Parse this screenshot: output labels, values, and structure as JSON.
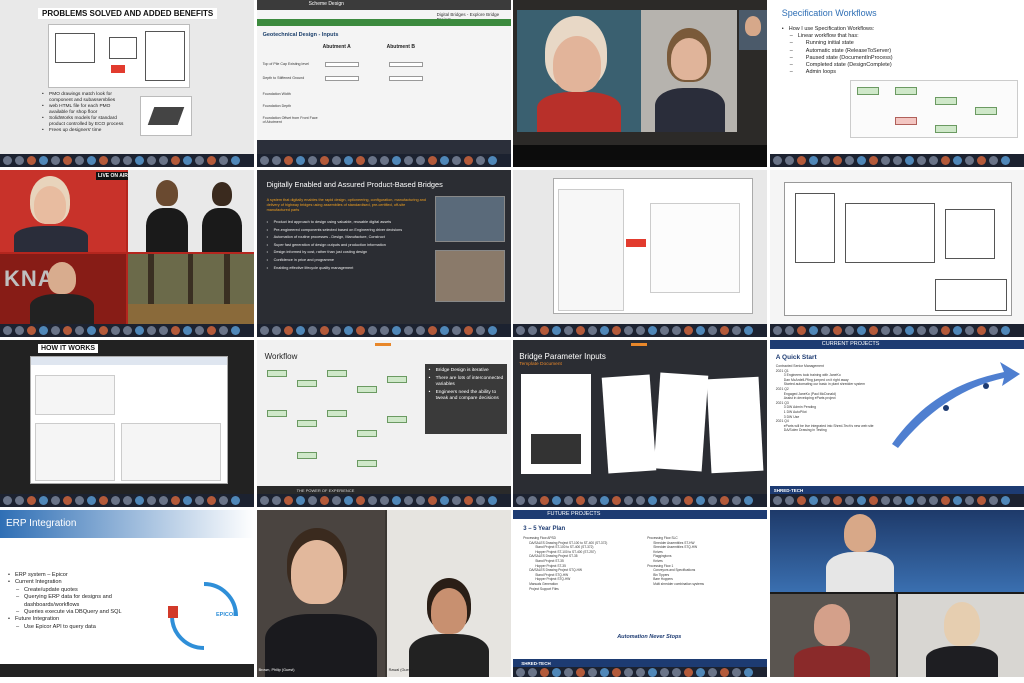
{
  "t1": {
    "title": "PROBLEMS SOLVED AND ADDED BENEFITS",
    "bullets": [
      "PMO drawings match look for component and subassemblies",
      "web HTML file for each PMO available for shop floor",
      "SolidWorks models for standard product controlled by ECO process",
      "Frees up designers' time"
    ]
  },
  "t2": {
    "app_title": "Scheme Design",
    "right_title": "Digital Bridges - Explore Bridge Project",
    "section_title": "Geotechnical Design - Inputs",
    "abutment_a": "Abutment A",
    "abutment_b": "Abutment B",
    "rows": [
      "Top of Pile Cap Existing level",
      "Depth to Stiffened Ground",
      "Foundation Width",
      "Foundation Depth",
      "Foundation Offset from Front Face of Abutment"
    ]
  },
  "t4": {
    "title": "Specification Workflows",
    "line1": "How I use Specification Workflows:",
    "line2": "Linear workflow that has:",
    "items": [
      "Running initial state",
      "Automatic state (ReleaseToServer)",
      "Paused state (DocumentInProcess)",
      "Completed state (DesignComplete)",
      "Admin loops"
    ]
  },
  "t5": {
    "badge": "LIVE ON AIR",
    "logo": "KNA"
  },
  "t6": {
    "title": "Digitally Enabled and Assured Product-Based Bridges",
    "intro": "A system that digitally enables the rapid design, optioneering, configuration, manufacturing and delivery of highway bridges using assemblies of standardised, pre-certified, off-site manufactured parts",
    "bullets": [
      "Product led approach to design using valuable, reusable digital assets",
      "Pre-engineered components selected based on Engineering driver decisions",
      "Automation of routine processes - Design, Manufacture, Construct",
      "Super fast generation of design outputs and production information",
      "Design informed by cost, rather than just costing design",
      "Confidence in price and programme",
      "Enabling effective lifecycle quality management"
    ]
  },
  "t9": {
    "title": "HOW IT WORKS"
  },
  "t10": {
    "title": "Workflow",
    "bullets": [
      "Bridge Design is iterative",
      "There are lots of interconnected variables",
      "Engineers need the ability to tweak and compare decisions"
    ],
    "footer": "THE POWER OF EXPERIENCE"
  },
  "t11": {
    "title": "Bridge Parameter Inputs",
    "subtitle": "Template Document"
  },
  "t12": {
    "header": "CURRENT PROJECTS",
    "title": "A Quick Start",
    "lines": [
      "Contracted Senior Management",
      "2021 Q1",
      "3 Engineers took training with JaneKo",
      "Dan McArdell-Pling jumped on it right away",
      "Started automating our basic in plant shredder system",
      "2021 Q2",
      "Engaged JaneKo (Paul McDonald)",
      "Assist in developing eParts project",
      "2021 Q3",
      "3 DW Admin Pending",
      "1 DW AutoPilot",
      "3 DW Use",
      "2021 Q4",
      "eParts will be live integrated into Shred-Tech's new web site",
      "DA/Solen Drawing in Testing"
    ],
    "logo": "SHRED-TECH"
  },
  "t13": {
    "title": "ERP Integration",
    "bullets": [
      {
        "text": "ERP system – Epicor",
        "sub": false
      },
      {
        "text": "Current Integration",
        "sub": false
      },
      {
        "text": "Create/update quotes",
        "sub": true
      },
      {
        "text": "Querying ERP data for designs and dashboards/workflows",
        "sub": true
      },
      {
        "text": "Queries execute via DBQuery and SQL",
        "sub": true
      },
      {
        "text": "Future Integration",
        "sub": false
      },
      {
        "text": "Use Epicor API to query data",
        "sub": true
      }
    ],
    "logo": "EPICOR"
  },
  "t14": {
    "name_left": "Brown, Philip (Guest)",
    "name_right": "Rawal (Guest)"
  },
  "t15": {
    "header": "FUTURE PROJECTS",
    "title": "3 – 5 Year Plan",
    "left": [
      "Processing Flow APSD",
      "DA/SALES Drawing Project ST-100 to ST-400 (ST-372)",
      "Stand Project ST-100 to ST-400 (ST-372)",
      "Hopper Project ST-100 to ST-400 (ST-257)",
      "DA/SALES Drawing Project ST-35",
      "Stand Project ST-35",
      "Hopper Project ST-35",
      "DA/SALES Drawing Project STQ-HW",
      "Stand Project STQ-HW",
      "Hopper Project STQ-HW",
      "Manuals Generation",
      "Project Support Files"
    ],
    "right": [
      "Processing Flow SLC",
      "Shredder Assemblies ST-HW",
      "Shredder Assemblies STQ-HW",
      "Knives",
      "Flaggingtons",
      "Knives",
      "Processing Flow 1",
      "Conveyors and Specifications",
      "Bin Tippers",
      "Bare Hoppers",
      "Multi shredder combination systems"
    ],
    "tagline": "Automation Never Stops",
    "logo": "SHRED-TECH"
  },
  "colors": {
    "accent_blue": "#2f6fb5",
    "dark_slide": "#2b2d33",
    "taskbar": "#1c2230",
    "green_box": "#cfe8c9",
    "red_arrow": "#e23b2e"
  }
}
